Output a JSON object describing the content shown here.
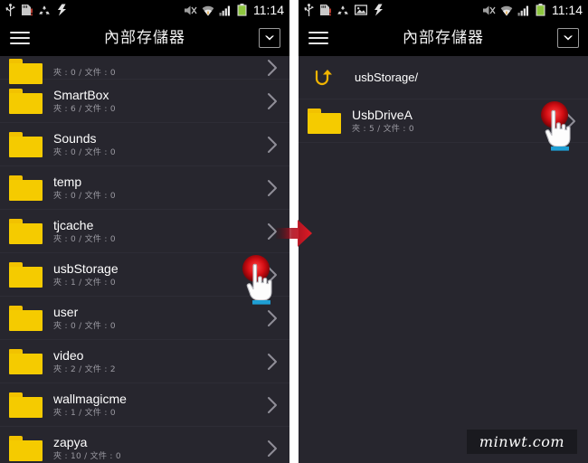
{
  "status_bar": {
    "icons_left": [
      "usb-icon",
      "sdcard-alert-icon",
      "recycle-icon",
      "sync-bolt-icon"
    ],
    "icons_left_right_panel": [
      "usb-icon",
      "sdcard-alert-icon",
      "recycle-icon",
      "image-icon",
      "sync-bolt-icon"
    ],
    "icons_right": [
      "mute-icon",
      "wifi-icon",
      "signal-icon",
      "battery-icon"
    ],
    "clock": "11:14",
    "battery_color": "#8ec63f"
  },
  "action_bar": {
    "menu_icon": "hamburger-icon",
    "title": "內部存儲器",
    "dropdown_icon": "chevron-down-icon"
  },
  "colors": {
    "background": "#27262e",
    "folder": "#f5cb00",
    "accent_red": "#d20d13",
    "text": "#ffffff",
    "subtext": "#9b9aa2"
  },
  "left_panel": {
    "rows": [
      {
        "name": "",
        "sub": "夾 : 0 / 文件 : 0",
        "clipped": true
      },
      {
        "name": "SmartBox",
        "sub": "夾 : 6 / 文件 : 0"
      },
      {
        "name": "Sounds",
        "sub": "夾 : 0 / 文件 : 0"
      },
      {
        "name": "temp",
        "sub": "夾 : 0 / 文件 : 0"
      },
      {
        "name": "tjcache",
        "sub": "夾 : 0 / 文件 : 0"
      },
      {
        "name": "usbStorage",
        "sub": "夾 : 1 / 文件 : 0",
        "tapped": true
      },
      {
        "name": "user",
        "sub": "夾 : 0 / 文件 : 0"
      },
      {
        "name": "video",
        "sub": "夾 : 2 / 文件 : 2"
      },
      {
        "name": "wallmagicme",
        "sub": "夾 : 1 / 文件 : 0"
      },
      {
        "name": "zapya",
        "sub": "夾 : 10 / 文件 : 0"
      }
    ]
  },
  "right_panel": {
    "breadcrumb": {
      "icon": "back-arrow-icon",
      "path": "usbStorage/"
    },
    "rows": [
      {
        "name": "UsbDriveA",
        "sub": "夾 : 5 / 文件 : 0",
        "tapped": true
      }
    ]
  },
  "transition": {
    "icon": "right-arrow-icon",
    "color": "#e01b24"
  },
  "watermark": {
    "text": "minwt.com"
  }
}
